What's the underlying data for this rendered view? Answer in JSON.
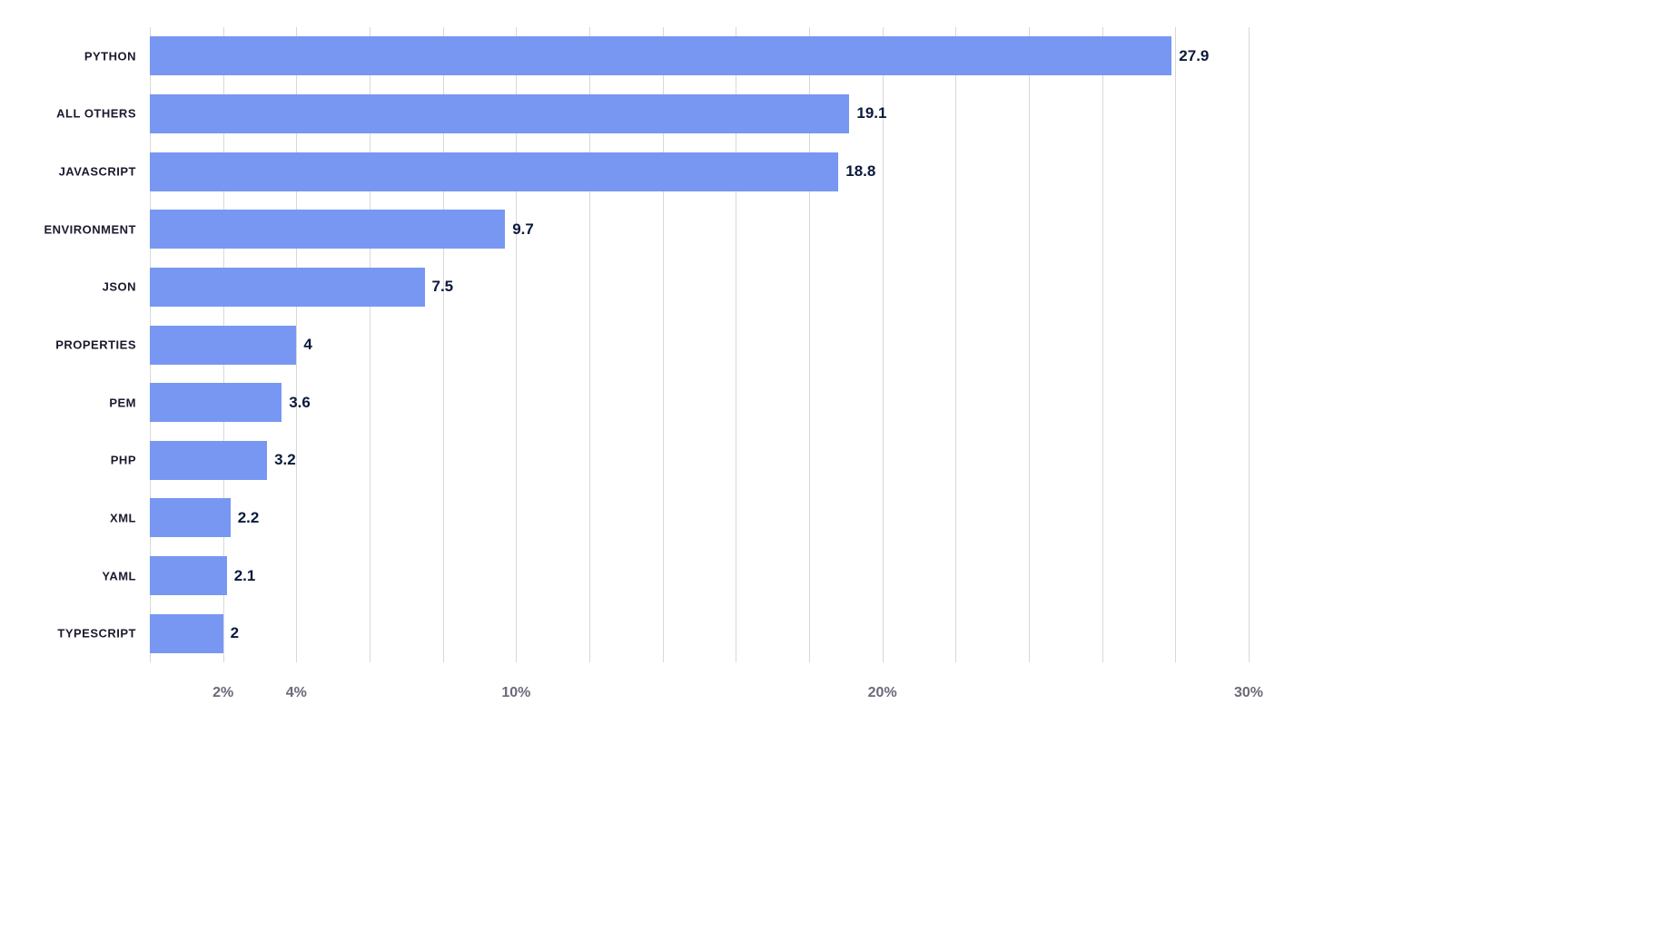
{
  "chart_data": {
    "type": "bar",
    "orientation": "horizontal",
    "categories": [
      "PYTHON",
      "ALL OTHERS",
      "JAVASCRIPT",
      "ENVIRONMENT",
      "JSON",
      "PROPERTIES",
      "PEM",
      "PHP",
      "XML",
      "YAML",
      "TYPESCRIPT"
    ],
    "values": [
      27.9,
      19.1,
      18.8,
      9.7,
      7.5,
      4,
      3.6,
      3.2,
      2.2,
      2.1,
      2
    ],
    "value_labels": [
      "27.9",
      "19.1",
      "18.8",
      "9.7",
      "7.5",
      "4",
      "3.6",
      "3.2",
      "2.2",
      "2.1",
      "2"
    ],
    "xlabel": "",
    "ylabel": "",
    "xlim": [
      0,
      30
    ],
    "x_ticks": [
      2,
      4,
      10,
      20,
      30
    ],
    "x_tick_labels": [
      "2%",
      "4%",
      "10%",
      "20%",
      "30%"
    ],
    "gridlines": [
      0,
      2,
      4,
      6,
      8,
      10,
      12,
      14,
      16,
      18,
      20,
      22,
      24,
      26,
      28,
      30
    ],
    "bar_color": "#7897f2"
  }
}
